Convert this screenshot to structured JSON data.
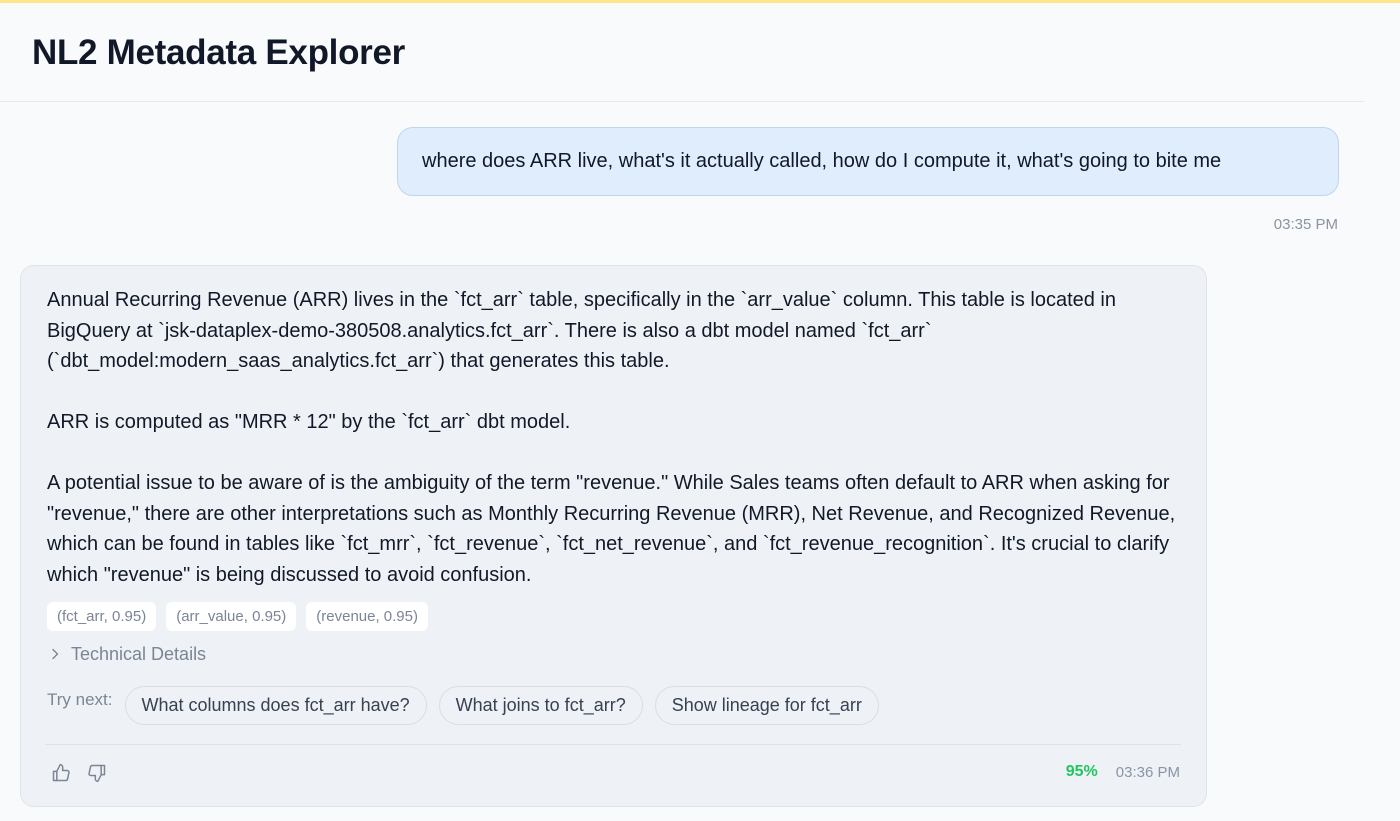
{
  "app": {
    "title": "NL2 Metadata Explorer"
  },
  "user_message": {
    "text": "where does ARR live, what's it actually called, how do I compute it, what's going to bite me",
    "time": "03:35 PM"
  },
  "assistant_message": {
    "paragraphs": [
      "Annual Recurring Revenue (ARR) lives in the `fct_arr` table, specifically in the `arr_value` column. This table is located in BigQuery at `jsk-dataplex-demo-380508.analytics.fct_arr`. There is also a dbt model named `fct_arr` (`dbt_model:modern_saas_analytics.fct_arr`) that generates this table.",
      "ARR is computed as \"MRR * 12\" by the `fct_arr` dbt model.",
      "A potential issue to be aware of is the ambiguity of the term \"revenue.\" While Sales teams often default to ARR when asking for \"revenue,\" there are other interpretations such as Monthly Recurring Revenue (MRR), Net Revenue, and Recognized Revenue, which can be found in tables like `fct_mrr`, `fct_revenue`, `fct_net_revenue`, and `fct_revenue_recognition`. It's crucial to clarify which \"revenue\" is being discussed to avoid confusion."
    ],
    "tags": [
      "(fct_arr, 0.95)",
      "(arr_value, 0.95)",
      "(revenue, 0.95)"
    ],
    "technical_details_label": "Technical Details",
    "try_next_label": "Try next:",
    "suggestions": [
      "What columns does fct_arr have?",
      "What joins to fct_arr?",
      "Show lineage for fct_arr"
    ],
    "confidence": "95%",
    "time": "03:36 PM",
    "icons": {
      "like": "thumbs-up-icon",
      "dislike": "thumbs-down-icon",
      "expand": "chevron-right-icon"
    }
  },
  "colors": {
    "accent": "#fde68a",
    "user_bubble": "#e0edfc",
    "confidence": "#22c55e"
  }
}
